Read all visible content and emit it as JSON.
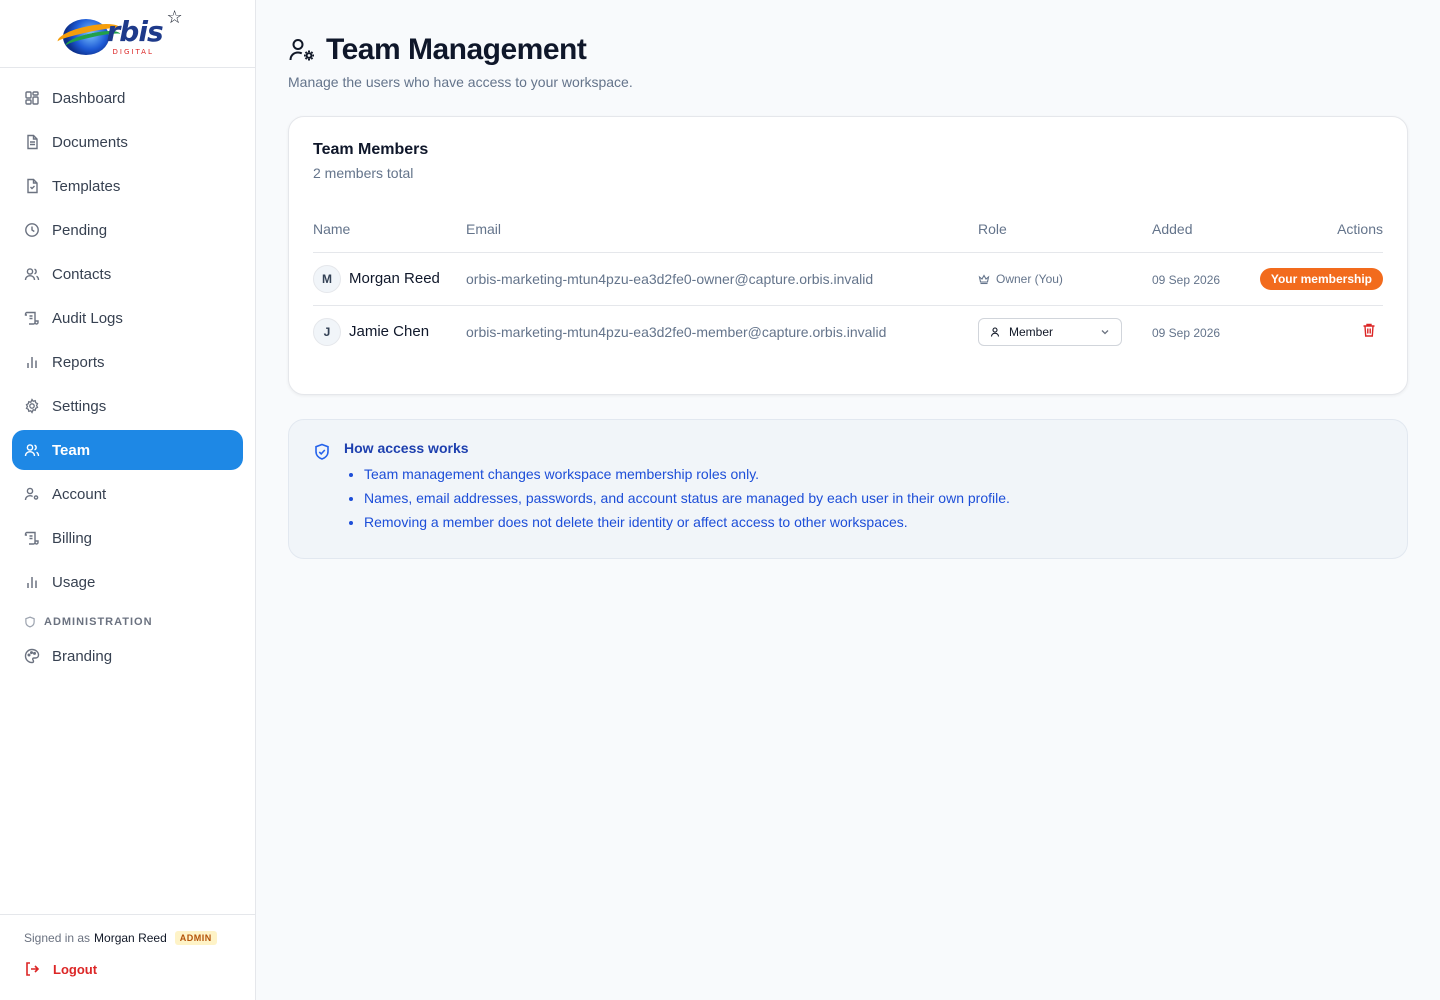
{
  "brand": {
    "name": "rbis",
    "sub": "DIGITAL",
    "initial": "O"
  },
  "sidebar": {
    "items": [
      {
        "label": "Dashboard",
        "icon": "dashboard-icon"
      },
      {
        "label": "Documents",
        "icon": "document-icon"
      },
      {
        "label": "Templates",
        "icon": "template-icon"
      },
      {
        "label": "Pending",
        "icon": "clock-icon"
      },
      {
        "label": "Contacts",
        "icon": "contacts-icon"
      },
      {
        "label": "Audit Logs",
        "icon": "scroll-icon"
      },
      {
        "label": "Reports",
        "icon": "bar-chart-icon"
      },
      {
        "label": "Settings",
        "icon": "gear-icon"
      },
      {
        "label": "Team",
        "icon": "users-icon",
        "active": true
      },
      {
        "label": "Account",
        "icon": "user-gear-icon"
      },
      {
        "label": "Billing",
        "icon": "scroll-icon"
      },
      {
        "label": "Usage",
        "icon": "bar-chart-icon"
      }
    ],
    "admin_section": "ADMINISTRATION",
    "admin_items": [
      {
        "label": "Branding",
        "icon": "palette-icon"
      }
    ],
    "footer": {
      "signed_in_prefix": "Signed in as",
      "user": "Morgan Reed",
      "role_badge": "ADMIN",
      "logout": "Logout"
    }
  },
  "page": {
    "title": "Team Management",
    "subtitle": "Manage the users who have access to your workspace."
  },
  "team_card": {
    "title": "Team Members",
    "count_text": "2 members total",
    "columns": [
      "Name",
      "Email",
      "Role",
      "Added",
      "Actions"
    ],
    "rows": [
      {
        "initial": "M",
        "name": "Morgan Reed",
        "email": "orbis-marketing-mtun4pzu-ea3d2fe0-owner@capture.orbis.invalid",
        "role": "Owner (You)",
        "added": "09 Sep 2026",
        "action": "Your membership"
      },
      {
        "initial": "J",
        "name": "Jamie Chen",
        "email": "orbis-marketing-mtun4pzu-ea3d2fe0-member@capture.orbis.invalid",
        "role": "Member",
        "added": "09 Sep 2026"
      }
    ]
  },
  "info": {
    "title": "How access works",
    "points": [
      "Team management changes workspace membership roles only.",
      "Names, email addresses, passwords, and account status are managed by each user in their own profile.",
      "Removing a member does not delete their identity or affect access to other workspaces."
    ]
  },
  "colors": {
    "accent": "#1e88e5",
    "danger": "#dc2626",
    "membership_pill": "#f26b1d",
    "info_text": "#1d4ed8"
  }
}
